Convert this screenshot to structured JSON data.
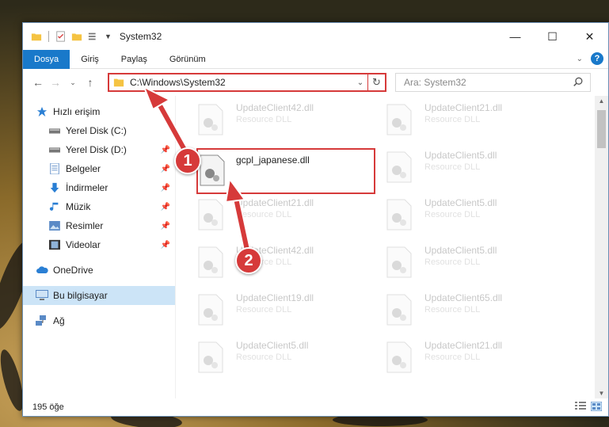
{
  "window": {
    "title": "System32"
  },
  "ribbon": {
    "tabs": [
      "Dosya",
      "Giriş",
      "Paylaş",
      "Görünüm"
    ]
  },
  "address": {
    "path": "C:\\Windows\\System32"
  },
  "search": {
    "placeholder": "Ara: System32"
  },
  "sidebar": {
    "items": [
      {
        "label": "Hızlı erişim",
        "icon": "star-icon"
      },
      {
        "label": "Yerel Disk (C:)",
        "icon": "drive-icon"
      },
      {
        "label": "Yerel Disk (D:)",
        "icon": "drive-icon"
      },
      {
        "label": "Belgeler",
        "icon": "documents-icon"
      },
      {
        "label": "İndirmeler",
        "icon": "download-icon"
      },
      {
        "label": "Müzik",
        "icon": "music-icon"
      },
      {
        "label": "Resimler",
        "icon": "pictures-icon"
      },
      {
        "label": "Videolar",
        "icon": "video-icon"
      },
      {
        "label": "OneDrive",
        "icon": "cloud-icon"
      },
      {
        "label": "Bu bilgisayar",
        "icon": "computer-icon"
      },
      {
        "label": "Ağ",
        "icon": "network-icon"
      }
    ]
  },
  "files": [
    {
      "name": "UpdateClient42.dll",
      "type": "Resource DLL"
    },
    {
      "name": "UpdateClient21.dll",
      "type": "Resource DLL"
    },
    {
      "name": "gcpl_japanese.dll",
      "type": ""
    },
    {
      "name": "UpdateClient5.dll",
      "type": "Resource DLL"
    },
    {
      "name": "UpdateClient21.dll",
      "type": "Resource DLL"
    },
    {
      "name": "UpdateClient5.dll",
      "type": "Resource DLL"
    },
    {
      "name": "UpdateClient42.dll",
      "type": "Resource DLL"
    },
    {
      "name": "UpdateClient5.dll",
      "type": "Resource DLL"
    },
    {
      "name": "UpdateClient19.dll",
      "type": "Resource DLL"
    },
    {
      "name": "UpdateClient65.dll",
      "type": "Resource DLL"
    },
    {
      "name": "UpdateClient5.dll",
      "type": "Resource DLL"
    },
    {
      "name": "UpdateClient21.dll",
      "type": "Resource DLL"
    }
  ],
  "status": {
    "count": "195 öğe"
  },
  "annotations": {
    "step1": "1",
    "step2": "2"
  },
  "colors": {
    "accent": "#1979ca",
    "highlight": "#d63a3a"
  }
}
